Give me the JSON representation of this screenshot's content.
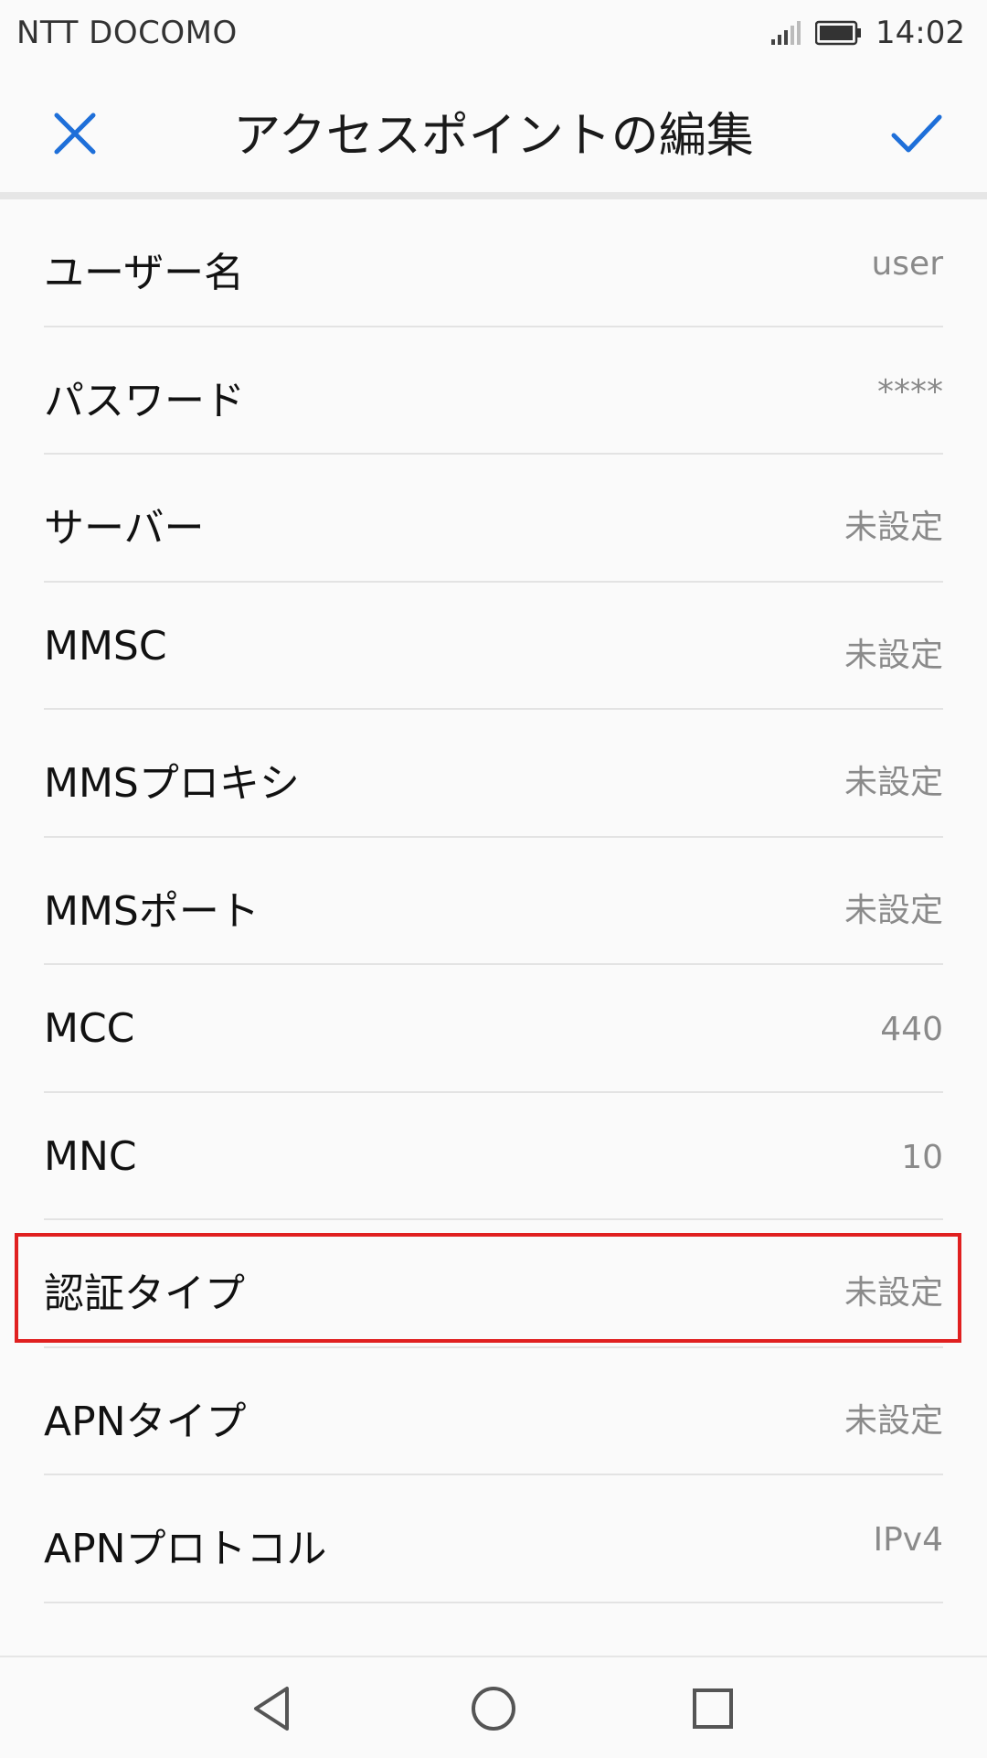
{
  "status_bar": {
    "carrier": "NTT DOCOMO",
    "time": "14:02",
    "signal_icon": "signal-icon",
    "battery_icon": "battery-icon"
  },
  "header": {
    "title": "アクセスポイントの編集",
    "close_icon": "close-icon",
    "confirm_icon": "check-icon",
    "accent_color": "#1e6fd9"
  },
  "settings": {
    "items": [
      {
        "label": "ユーザー名",
        "value": "user"
      },
      {
        "label": "パスワード",
        "value": "****"
      },
      {
        "label": "サーバー",
        "value": "未設定"
      },
      {
        "label": "MMSC",
        "value": "未設定"
      },
      {
        "label": "MMSプロキシ",
        "value": "未設定"
      },
      {
        "label": "MMSポート",
        "value": "未設定"
      },
      {
        "label": "MCC",
        "value": "440"
      },
      {
        "label": "MNC",
        "value": "10"
      },
      {
        "label": "認証タイプ",
        "value": "未設定"
      },
      {
        "label": "APNタイプ",
        "value": "未設定"
      },
      {
        "label": "APNプロトコル",
        "value": "IPv4"
      }
    ],
    "highlighted_item": "認証タイプ",
    "highlight_color": "#e02020"
  },
  "nav_bar": {
    "back_icon": "back-triangle-icon",
    "home_icon": "home-circle-icon",
    "recents_icon": "recents-square-icon"
  }
}
